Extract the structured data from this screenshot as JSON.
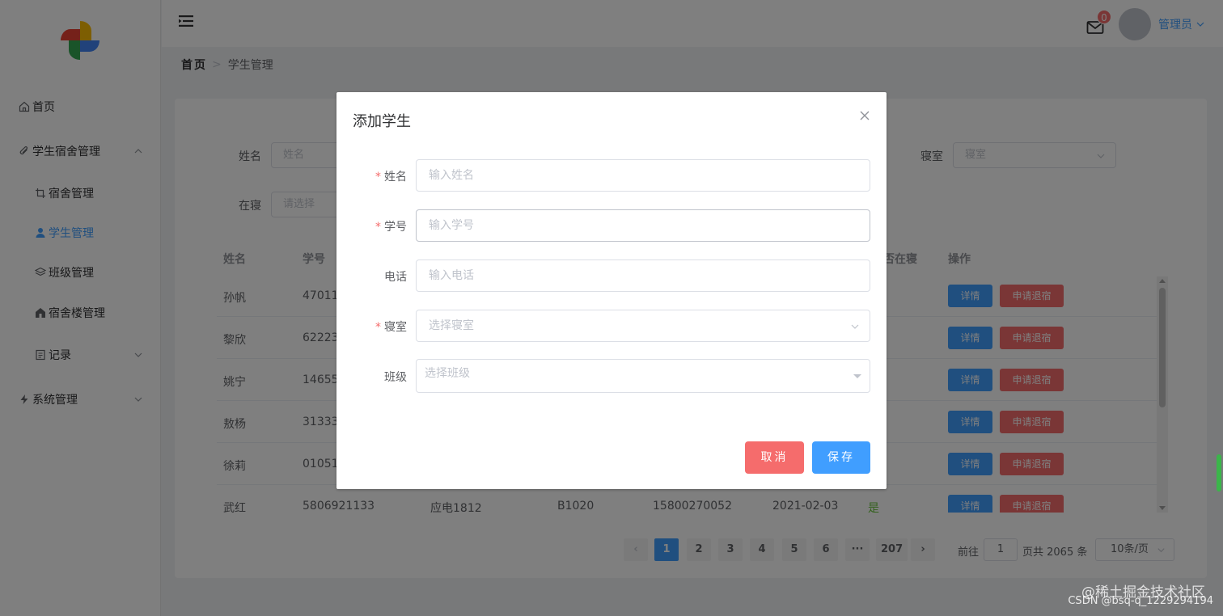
{
  "sidebar": {
    "items": [
      {
        "label": "首页",
        "icon": "home-icon"
      },
      {
        "label": "学生宿舍管理",
        "icon": "paperclip-icon"
      },
      {
        "label": "宿舍管理",
        "icon": "crop-icon"
      },
      {
        "label": "学生管理",
        "icon": "user-icon"
      },
      {
        "label": "班级管理",
        "icon": "layers-icon"
      },
      {
        "label": "宿舍楼管理",
        "icon": "building-icon"
      },
      {
        "label": "记录",
        "icon": "document-icon"
      },
      {
        "label": "系统管理",
        "icon": "lightning-icon"
      }
    ]
  },
  "header": {
    "badge": "0",
    "user": "管理员"
  },
  "breadcrumb": {
    "home": "首页",
    "current": "学生管理"
  },
  "filters": {
    "name_label": "姓名",
    "name_placeholder": "姓名",
    "dorm_label": "寝室",
    "dorm_placeholder": "寝室",
    "in_label": "在寝",
    "in_placeholder": "请选择"
  },
  "table": {
    "headers": {
      "name": "姓名",
      "id": "学号",
      "in": "否在寝",
      "ops": "操作"
    },
    "detail_label": "详情",
    "leave_label": "申请退宿",
    "rows": [
      {
        "name": "孙帆",
        "id": "47011"
      },
      {
        "name": "黎欣",
        "id": "62223"
      },
      {
        "name": "姚宁",
        "id": "14655"
      },
      {
        "name": "敖杨",
        "id": "31333"
      },
      {
        "name": "徐莉",
        "id": "01051"
      },
      {
        "name": "武红",
        "id": "5806921133",
        "cls": "应电1812",
        "dorm": "B1020",
        "phone": "15800270052",
        "date": "2021-02-03",
        "in": "是"
      }
    ]
  },
  "pagination": {
    "pages": [
      "1",
      "2",
      "3",
      "4",
      "5",
      "6",
      "···",
      "207"
    ],
    "goto": "前往",
    "current": "1",
    "total": "页共 2065 条",
    "size": "10条/页"
  },
  "dialog": {
    "title": "添加学生",
    "fields": [
      {
        "label": "姓名",
        "required": "*",
        "placeholder": "输入姓名"
      },
      {
        "label": "学号",
        "required": "*",
        "placeholder": "输入学号"
      },
      {
        "label": "电话",
        "required": "",
        "placeholder": "输入电话"
      },
      {
        "label": "寝室",
        "required": "*",
        "placeholder": "选择寝室"
      },
      {
        "label": "班级",
        "required": "",
        "placeholder": "选择班级"
      }
    ],
    "cancel": "取消",
    "save": "保存"
  },
  "watermark": {
    "line1": "@稀土掘金技术社区",
    "line2": "CSDN @bsq-q_1229294194"
  },
  "colors": {
    "primary": "#409eff",
    "danger": "#f56c6c",
    "success": "#67c23a"
  }
}
